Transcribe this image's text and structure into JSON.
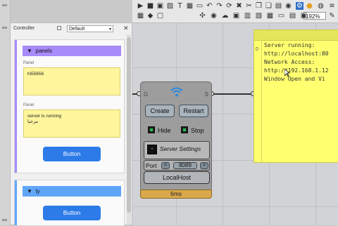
{
  "toolbar": {
    "zoom": "192%",
    "icons": [
      "play-icon",
      "stop-icon",
      "save-icon",
      "image-icon",
      "text-icon",
      "grid-icon",
      "window-icon",
      "undo-icon",
      "redo-icon",
      "refresh-icon",
      "delete-icon",
      "cut-icon",
      "copy-icon",
      "paste-icon",
      "ruler-icon",
      "eye-icon",
      "settings-icon",
      "preview-icon",
      "cloud-icon",
      "globe-icon",
      "menu-icon"
    ]
  },
  "controller": {
    "title": "Controller",
    "dropdown": "Default",
    "groups": [
      {
        "title": "panels",
        "accent": "#a78bfa",
        "panels": [
          {
            "label": "Panel",
            "text": "hi55656"
          },
          {
            "label": "Panel",
            "text": "server is running\nمرحبا"
          }
        ],
        "button": "Button"
      },
      {
        "title": "ty",
        "accent": "#60a5fa",
        "button": "Button"
      }
    ]
  },
  "node": {
    "input_label": "G",
    "output_label": "S",
    "create": "Create",
    "restart": "Restart",
    "hide": "Hide",
    "stop": "Stop",
    "server_settings": "Server Settings",
    "port_label": "Port",
    "port_value": "8089",
    "dec": "<",
    "inc": ">",
    "localhost": "LocalHost",
    "toggle": "-",
    "time": "6ms"
  },
  "output_panel": {
    "index": "0",
    "text": "Server running:\nhttp://localhost:80\nNetwork Access:\nhttp://192.168.1.12\nWindow Open and Vi"
  }
}
